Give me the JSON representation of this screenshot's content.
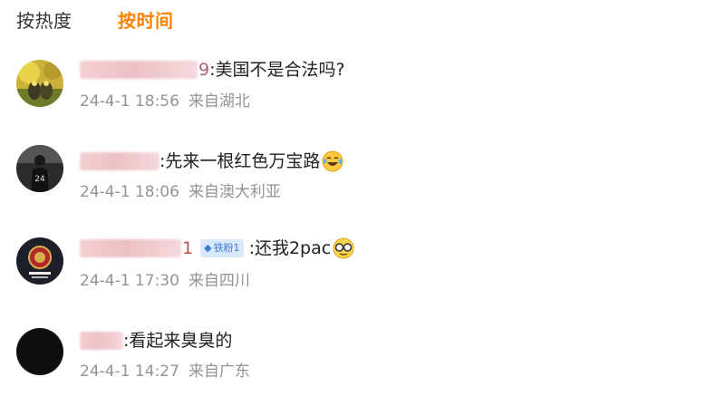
{
  "tabs": {
    "hot_label": "按热度",
    "time_label": "按时间"
  },
  "colors": {
    "accent": "#ff8200",
    "meta": "#939393",
    "badge_bg": "#d9e9fb",
    "badge_text": "#3b7fd3"
  },
  "comments": [
    {
      "name_tail": "9",
      "text": ":美国不是合法吗?",
      "time": "24-4-1 18:56",
      "location": "来自湖北"
    },
    {
      "name_tail": "",
      "text": ":先来一根红色万宝路",
      "emoji": "laughing-tears-emoji",
      "time": "24-4-1 18:06",
      "location": "来自澳大利亚"
    },
    {
      "name_tail": "1",
      "badge": "铁粉1",
      "text": ":还我2pac",
      "emoji": "glasses-emoji",
      "time": "24-4-1 17:30",
      "location": "来自四川"
    },
    {
      "name_tail": "",
      "text": ":看起来臭臭的",
      "time": "24-4-1 14:27",
      "location": "来自广东"
    }
  ]
}
